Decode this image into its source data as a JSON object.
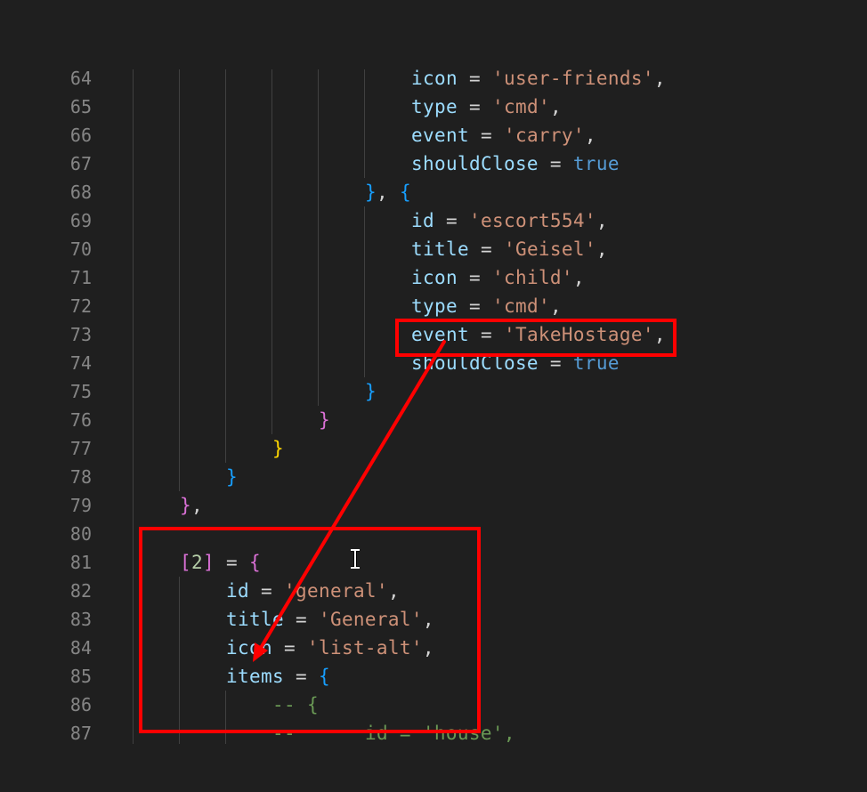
{
  "editor": {
    "theme_colors": {
      "background": "#1f1f1f",
      "line_number": "#858585",
      "key": "#9cdcfe",
      "string": "#ce9178",
      "boolean": "#569cd6",
      "number": "#b5cea8",
      "comment": "#6a9955",
      "bracket_blue": "#179fff",
      "bracket_pink": "#da70d6",
      "bracket_gold": "#ffd700",
      "annotation_red": "#ff0000"
    },
    "lines": [
      {
        "num": "64",
        "indent": 6,
        "tokens": [
          [
            "k",
            "icon"
          ],
          [
            "o",
            " = "
          ],
          [
            "s",
            "'user-friends'"
          ],
          [
            "o",
            ","
          ]
        ]
      },
      {
        "num": "65",
        "indent": 6,
        "tokens": [
          [
            "k",
            "type"
          ],
          [
            "o",
            " = "
          ],
          [
            "s",
            "'cmd'"
          ],
          [
            "o",
            ","
          ]
        ]
      },
      {
        "num": "66",
        "indent": 6,
        "tokens": [
          [
            "k",
            "event"
          ],
          [
            "o",
            " = "
          ],
          [
            "s",
            "'carry'"
          ],
          [
            "o",
            ","
          ]
        ]
      },
      {
        "num": "67",
        "indent": 6,
        "tokens": [
          [
            "k",
            "shouldClose"
          ],
          [
            "o",
            " = "
          ],
          [
            "b",
            "true"
          ]
        ]
      },
      {
        "num": "68",
        "indent": 5,
        "tokens": [
          [
            "br-blue",
            "}"
          ],
          [
            "o",
            ", "
          ],
          [
            "br-blue",
            "{"
          ]
        ]
      },
      {
        "num": "69",
        "indent": 6,
        "tokens": [
          [
            "k",
            "id"
          ],
          [
            "o",
            " = "
          ],
          [
            "s",
            "'escort554'"
          ],
          [
            "o",
            ","
          ]
        ]
      },
      {
        "num": "70",
        "indent": 6,
        "tokens": [
          [
            "k",
            "title"
          ],
          [
            "o",
            " = "
          ],
          [
            "s",
            "'Geisel'"
          ],
          [
            "o",
            ","
          ]
        ]
      },
      {
        "num": "71",
        "indent": 6,
        "tokens": [
          [
            "k",
            "icon"
          ],
          [
            "o",
            " = "
          ],
          [
            "s",
            "'child'"
          ],
          [
            "o",
            ","
          ]
        ]
      },
      {
        "num": "72",
        "indent": 6,
        "tokens": [
          [
            "k",
            "type"
          ],
          [
            "o",
            " = "
          ],
          [
            "s",
            "'cmd'"
          ],
          [
            "o",
            ","
          ]
        ]
      },
      {
        "num": "73",
        "indent": 6,
        "tokens": [
          [
            "k",
            "event"
          ],
          [
            "o",
            " = "
          ],
          [
            "s",
            "'TakeHostage'"
          ],
          [
            "o",
            ","
          ]
        ]
      },
      {
        "num": "74",
        "indent": 6,
        "tokens": [
          [
            "k",
            "shouldClose"
          ],
          [
            "o",
            " = "
          ],
          [
            "b",
            "true"
          ]
        ]
      },
      {
        "num": "75",
        "indent": 5,
        "tokens": [
          [
            "br-blue",
            "}"
          ]
        ]
      },
      {
        "num": "76",
        "indent": 4,
        "tokens": [
          [
            "br-pink",
            "}"
          ]
        ]
      },
      {
        "num": "77",
        "indent": 3,
        "tokens": [
          [
            "br-gold",
            "}"
          ]
        ]
      },
      {
        "num": "78",
        "indent": 2,
        "tokens": [
          [
            "br-blue",
            "}"
          ]
        ]
      },
      {
        "num": "79",
        "indent": 1,
        "tokens": [
          [
            "br-pink",
            "}"
          ],
          [
            "o",
            ","
          ]
        ]
      },
      {
        "num": "80",
        "indent": 1,
        "tokens": []
      },
      {
        "num": "81",
        "indent": 1,
        "tokens": [
          [
            "br-pink",
            "["
          ],
          [
            "n",
            "2"
          ],
          [
            "br-pink",
            "]"
          ],
          [
            "o",
            " = "
          ],
          [
            "br-pink",
            "{"
          ]
        ]
      },
      {
        "num": "82",
        "indent": 2,
        "tokens": [
          [
            "k",
            "id"
          ],
          [
            "o",
            " = "
          ],
          [
            "s",
            "'general'"
          ],
          [
            "o",
            ","
          ]
        ]
      },
      {
        "num": "83",
        "indent": 2,
        "tokens": [
          [
            "k",
            "title"
          ],
          [
            "o",
            " = "
          ],
          [
            "s",
            "'General'"
          ],
          [
            "o",
            ","
          ]
        ]
      },
      {
        "num": "84",
        "indent": 2,
        "tokens": [
          [
            "k",
            "icon"
          ],
          [
            "o",
            " = "
          ],
          [
            "s",
            "'list-alt'"
          ],
          [
            "o",
            ","
          ]
        ]
      },
      {
        "num": "85",
        "indent": 2,
        "tokens": [
          [
            "k",
            "items"
          ],
          [
            "o",
            " = "
          ],
          [
            "br-blue",
            "{"
          ]
        ]
      },
      {
        "num": "86",
        "indent": 3,
        "tokens": [
          [
            "c",
            "-- {"
          ]
        ]
      },
      {
        "num": "87",
        "indent": 3,
        "tokens": [
          [
            "c",
            "--      id = 'house',"
          ]
        ]
      }
    ]
  },
  "annotations": {
    "highlight_source_label": "event = 'TakeHostage',",
    "highlight_target_label": "[2] = { id = 'general', title = 'General', icon = 'list-alt', items = {"
  }
}
